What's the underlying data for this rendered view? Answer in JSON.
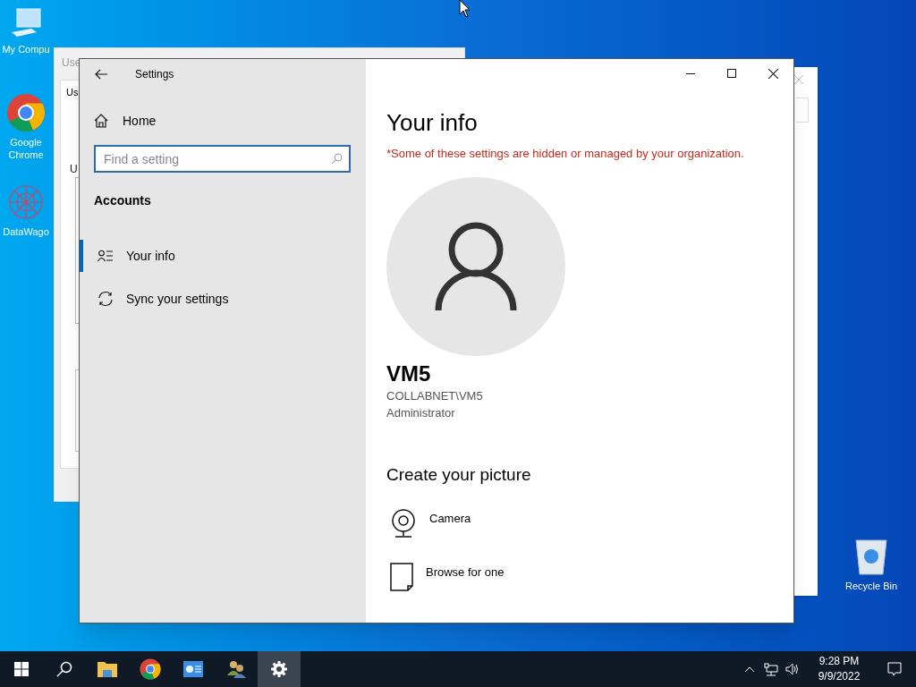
{
  "desktop_icons": [
    {
      "label": "My Compu",
      "kind": "computer"
    },
    {
      "label": "Google Chrome",
      "kind": "chrome"
    },
    {
      "label": "DataWago",
      "kind": "datawagon"
    },
    {
      "label": "Recycle Bin",
      "kind": "recycle"
    }
  ],
  "background_window": {
    "title": "Use",
    "tab": "Us",
    "label": "U"
  },
  "settings": {
    "title": "Settings",
    "home": "Home",
    "search_placeholder": "Find a setting",
    "section": "Accounts",
    "nav_items": [
      {
        "label": "Your info",
        "kind": "person",
        "selected": true
      },
      {
        "label": "Sync your settings",
        "kind": "sync",
        "selected": false
      }
    ],
    "page_title": "Your info",
    "warning": "*Some of these settings are hidden or managed by your organization.",
    "user": {
      "name": "VM5",
      "account": "COLLABNET\\VM5",
      "role": "Administrator"
    },
    "picture_heading": "Create your picture",
    "picture_options": [
      {
        "label": "Camera",
        "kind": "camera"
      },
      {
        "label": "Browse for one",
        "kind": "browse"
      }
    ]
  },
  "taskbar": {
    "items": [
      {
        "kind": "start",
        "selected": false
      },
      {
        "kind": "search",
        "selected": false
      },
      {
        "kind": "explorer",
        "selected": false
      },
      {
        "kind": "chrome",
        "selected": false
      },
      {
        "kind": "app",
        "selected": false
      },
      {
        "kind": "users",
        "selected": false
      },
      {
        "kind": "settings",
        "selected": true
      }
    ],
    "time": "9:28 PM",
    "date": "9/9/2022"
  }
}
